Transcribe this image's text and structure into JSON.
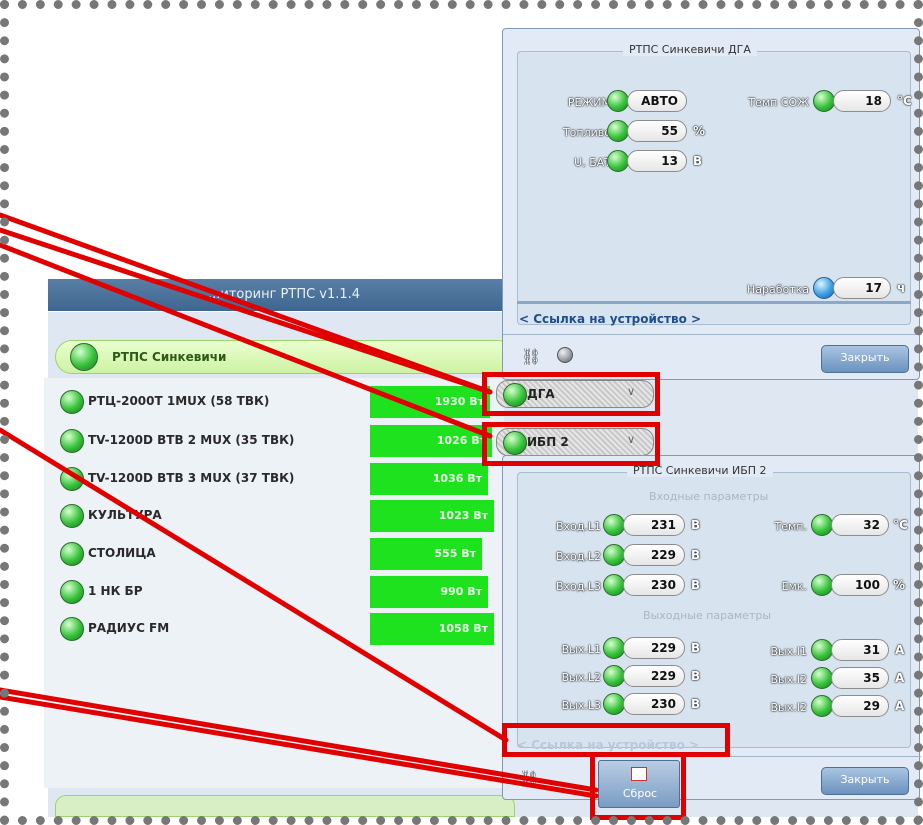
{
  "app": {
    "title": "...иторинг РТПС v1.1.4"
  },
  "station": {
    "name": "РТПС Синкевичи"
  },
  "transmitters": [
    {
      "name": "РТЦ-2000Т 1MUX (58 ТВК)",
      "power": "1930 Вт"
    },
    {
      "name": "TV-1200D ВТВ 2 MUX (35 ТВК)",
      "power": "1026 Вт"
    },
    {
      "name": "TV-1200D ВТВ 3 MUX (37 ТВК)",
      "power": "1036 Вт"
    },
    {
      "name": "КУЛЬТУРА",
      "power": "1023 Вт"
    },
    {
      "name": "СТОЛИЦА",
      "power": "555 Вт"
    },
    {
      "name": "1 НК БР",
      "power": "990 Вт"
    },
    {
      "name": "РАДИУС FM",
      "power": "1058 Вт"
    }
  ],
  "dga_panel": {
    "title": "РТПС Синкевичи ДГА",
    "mode_label": "РЕЖИМ",
    "mode_value": "АВТО",
    "fuel_label": "Топливо",
    "fuel_value": "55",
    "fuel_unit": "%",
    "bat_label": "U, БАТ",
    "bat_value": "13",
    "bat_unit": "В",
    "coolant_label": "Темп СОЖ",
    "coolant_value": "18",
    "coolant_unit": "°С",
    "runtime_label": "Наработка",
    "runtime_value": "17",
    "runtime_unit": "ч",
    "link": "< Ссылка на устройство >",
    "close": "Закрыть"
  },
  "dropdowns": {
    "dga": "ДГА",
    "ibp": "ИБП 2"
  },
  "ibp_panel": {
    "title": "РТПС Синкевичи ИБП 2",
    "inputs_title": "Входные параметры",
    "outputs_title": "Выходные параметры",
    "in_l1_label": "Вход.L1",
    "in_l1_value": "231",
    "in_l2_label": "Вход.L2",
    "in_l2_value": "229",
    "in_l3_label": "Вход.L3",
    "in_l3_value": "230",
    "v_unit": "В",
    "temp_label": "Темп.",
    "temp_value": "32",
    "temp_unit": "°С",
    "cap_label": "Емк.",
    "cap_value": "100",
    "cap_unit": "%",
    "out_l1_label": "Вых.L1",
    "out_l1_value": "229",
    "out_l2_label": "Вых.L2",
    "out_l2_value": "229",
    "out_l3_label": "Вых.L3",
    "out_l3_value": "230",
    "out_i1_label": "Вых.I1",
    "out_i1_value": "31",
    "out_i2_label": "Вых.I2",
    "out_i2_value": "35",
    "out_i3_label": "Вых.I2",
    "out_i3_value": "29",
    "a_unit": "А",
    "link": "< Ссылка на устройство >",
    "close": "Закрыть"
  },
  "reset": {
    "label": "Сброс"
  },
  "colors": {
    "annotation": "#e00000",
    "power_bar": "#1fe21f",
    "app_bar": "#4a7099"
  }
}
